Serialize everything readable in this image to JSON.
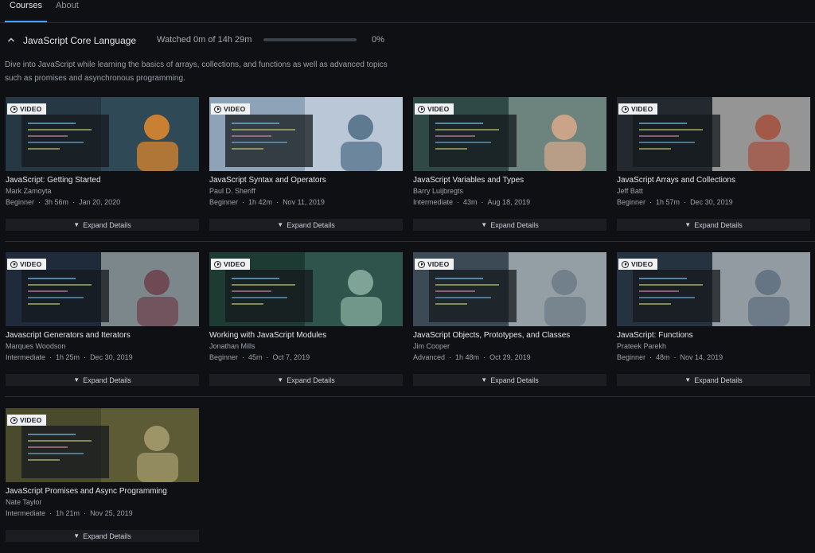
{
  "tabs": [
    {
      "label": "Courses",
      "active": true
    },
    {
      "label": "About",
      "active": false
    }
  ],
  "path": {
    "title": "JavaScript Core Language",
    "watched": "Watched 0m of 14h 29m",
    "progress_percent": 0,
    "progress_label": "0%",
    "description_line1": "Dive into JavaScript while learning the basics of arrays, collections, and functions as well as advanced topics",
    "description_line2": "such as promises and asynchronous programming."
  },
  "badge_label": "VIDEO",
  "expand_label": "Expand Details",
  "accent_color": "#4aa0ff",
  "courses": [
    {
      "title": "JavaScript: Getting Started",
      "author": "Mark Zamoyta",
      "level": "Beginner",
      "duration": "3h 56m",
      "date": "Jan 20, 2020",
      "thumb": {
        "c1": "#253844",
        "c2": "#3b5766",
        "c3": "#e58a2b"
      }
    },
    {
      "title": "JavaScript Syntax and Operators",
      "author": "Paul D. Sheriff",
      "level": "Beginner",
      "duration": "1h 42m",
      "date": "Nov 11, 2019",
      "thumb": {
        "c1": "#8fa3b8",
        "c2": "#dfe6ee",
        "c3": "#4c6c85"
      }
    },
    {
      "title": "JavaScript Variables and Types",
      "author": "Barry Luijbregts",
      "level": "Intermediate",
      "duration": "43m",
      "date": "Aug 18, 2019",
      "thumb": {
        "c1": "#2f4a46",
        "c2": "#9fb5ab",
        "c3": "#d9a98a"
      }
    },
    {
      "title": "JavaScript Arrays and Collections",
      "author": "Jeff Batt",
      "level": "Beginner",
      "duration": "1h 57m",
      "date": "Dec 30, 2019",
      "thumb": {
        "c1": "#23292e",
        "c2": "#f2efe9",
        "c3": "#a64f3b"
      }
    },
    {
      "title": "Javascript Generators and Iterators",
      "author": "Marques Woodson",
      "level": "Intermediate",
      "duration": "1h 25m",
      "date": "Dec 30, 2019",
      "thumb": {
        "c1": "#1f2a3a",
        "c2": "#c9d4cf",
        "c3": "#6d3e4a"
      }
    },
    {
      "title": "Working with JavaScript Modules",
      "author": "Jonathan Mills",
      "level": "Beginner",
      "duration": "45m",
      "date": "Oct 7, 2019",
      "thumb": {
        "c1": "#1d3a33",
        "c2": "#3e6a5e",
        "c3": "#8db3a5"
      }
    },
    {
      "title": "JavaScript Objects, Prototypes, and Classes",
      "author": "Jim Cooper",
      "level": "Advanced",
      "duration": "1h 48m",
      "date": "Oct 29, 2019",
      "thumb": {
        "c1": "#3b4a55",
        "c2": "#dfe4e8",
        "c3": "#6c7a86"
      }
    },
    {
      "title": "JavaScript: Functions",
      "author": "Prateek Parekh",
      "level": "Beginner",
      "duration": "48m",
      "date": "Nov 14, 2019",
      "thumb": {
        "c1": "#24333f",
        "c2": "#eef1f4",
        "c3": "#5d6e7e"
      }
    },
    {
      "title": "JavaScript Promises and Async Programming",
      "author": "Nate Taylor",
      "level": "Intermediate",
      "duration": "1h 21m",
      "date": "Nov 25, 2019",
      "thumb": {
        "c1": "#4a4a2c",
        "c2": "#6b6a40",
        "c3": "#a89f70"
      }
    }
  ]
}
